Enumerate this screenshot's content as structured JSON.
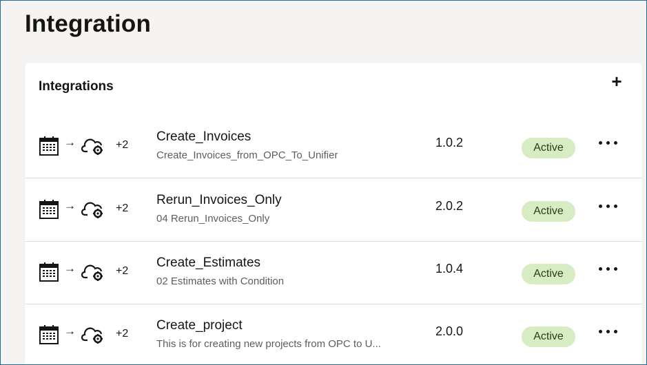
{
  "page": {
    "title": "Integration"
  },
  "card": {
    "title": "Integrations",
    "add_label": "+"
  },
  "rows": [
    {
      "name": "Create_Invoices",
      "description": "Create_Invoices_from_OPC_To_Unifier",
      "version": "1.0.2",
      "status": "Active",
      "extra_count": "+2",
      "arrow": "→"
    },
    {
      "name": "Rerun_Invoices_Only",
      "description": "04 Rerun_Invoices_Only",
      "version": "2.0.2",
      "status": "Active",
      "extra_count": "+2",
      "arrow": "→"
    },
    {
      "name": "Create_Estimates",
      "description": "02 Estimates with Condition",
      "version": "1.0.4",
      "status": "Active",
      "extra_count": "+2",
      "arrow": "→"
    },
    {
      "name": "Create_project",
      "description": "This is for creating new projects from OPC to U...",
      "version": "2.0.0",
      "status": "Active",
      "extra_count": "+2",
      "arrow": "→"
    }
  ],
  "icons": {
    "trigger": "calendar-icon",
    "target": "cloud-gear-icon",
    "more": "more-horizontal-icon"
  },
  "colors": {
    "status_bg": "#d7ecc2",
    "frame_border": "#1f6c9a",
    "page_bg": "#f5f4f2"
  }
}
